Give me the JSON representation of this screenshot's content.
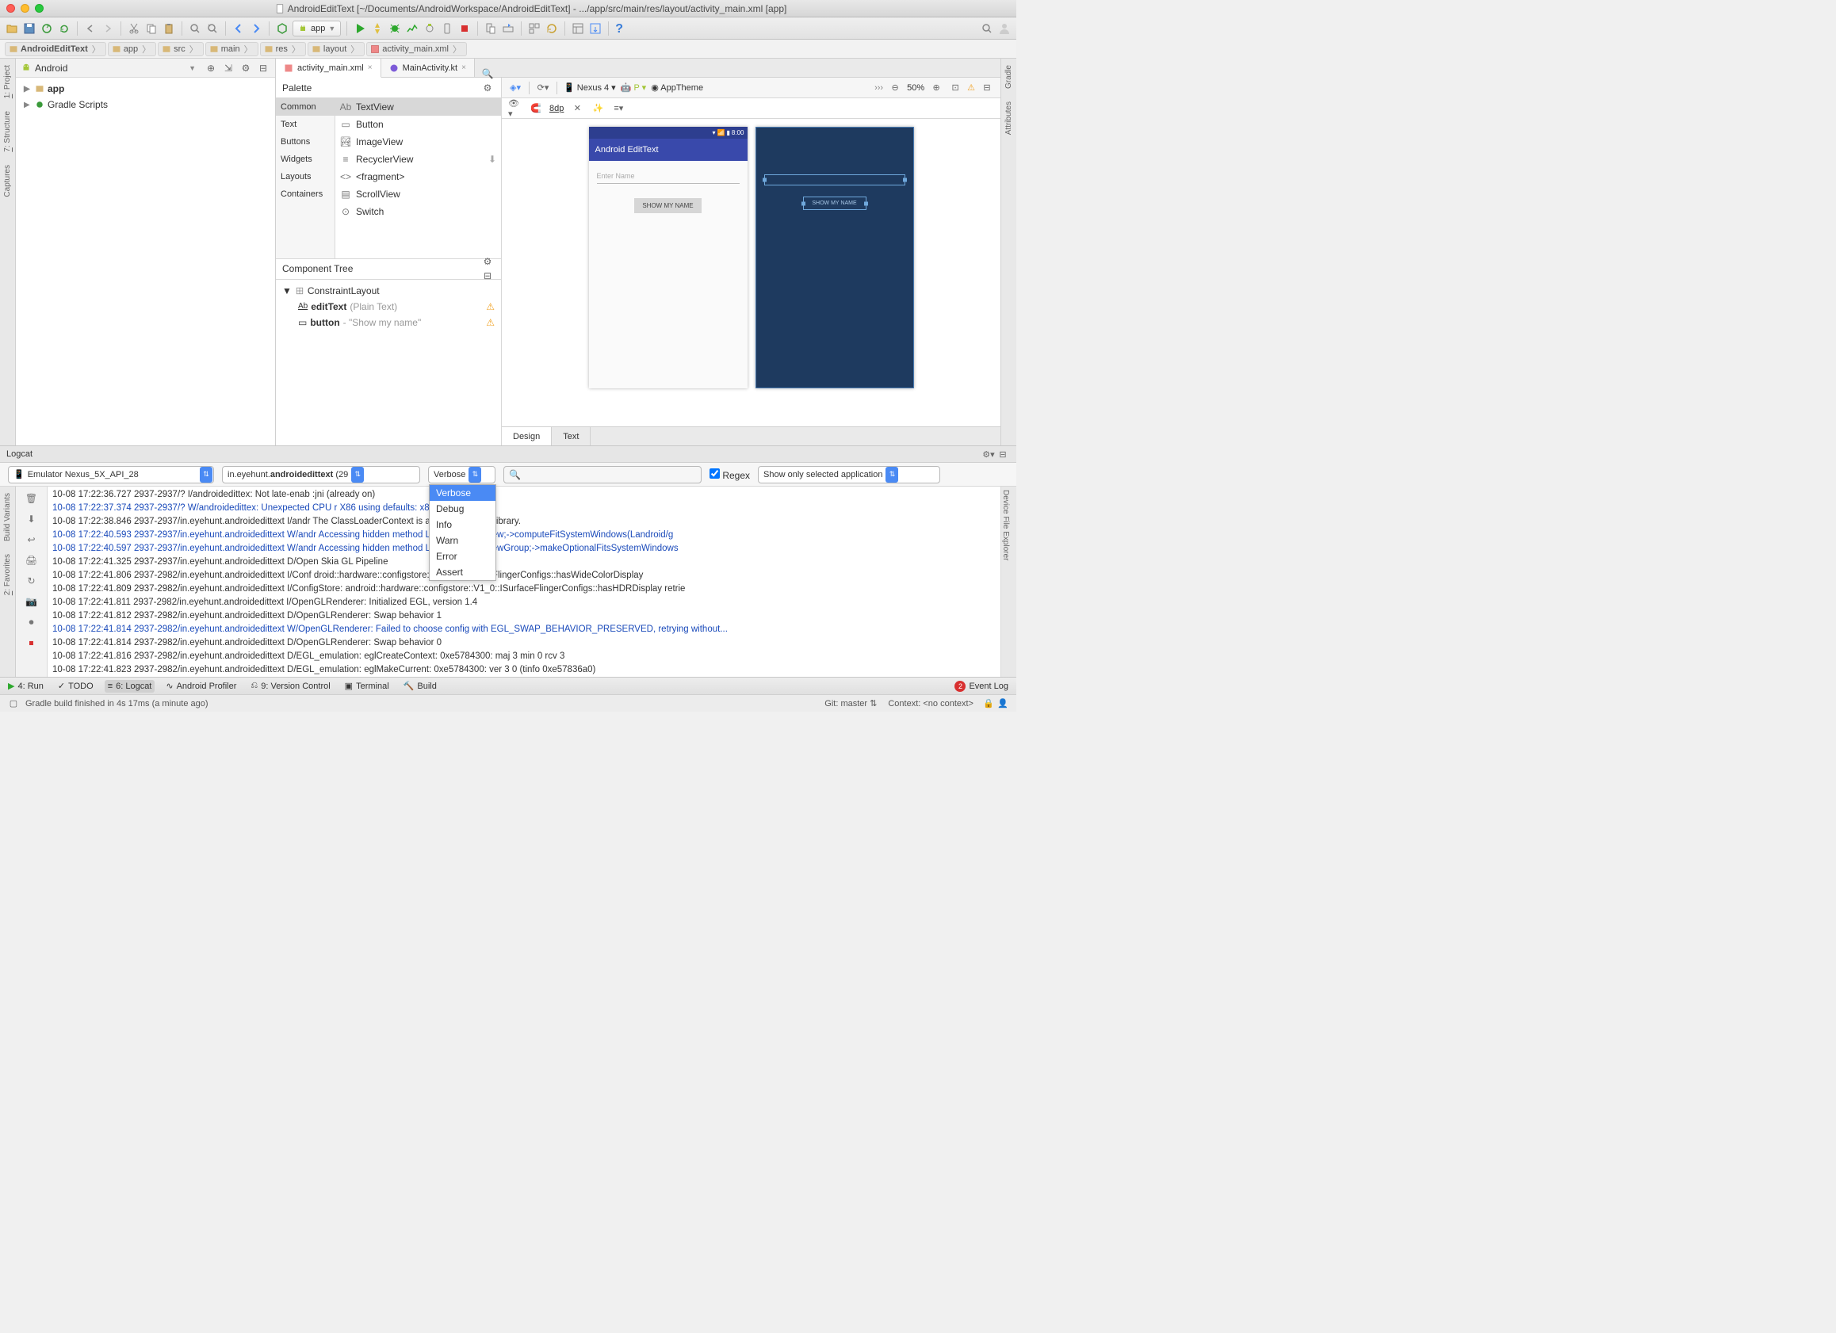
{
  "titlebar": {
    "title": "AndroidEditText [~/Documents/AndroidWorkspace/AndroidEditText] - .../app/src/main/res/layout/activity_main.xml [app]"
  },
  "toolbar": {
    "config": "app"
  },
  "breadcrumb": {
    "items": [
      "AndroidEditText",
      "app",
      "src",
      "main",
      "res",
      "layout",
      "activity_main.xml"
    ]
  },
  "project": {
    "view": "Android",
    "nodes": {
      "app": "app",
      "gradle": "Gradle Scripts"
    }
  },
  "editorTabs": {
    "tab1": "activity_main.xml",
    "tab2": "MainActivity.kt"
  },
  "palette": {
    "title": "Palette",
    "cats": [
      "Common",
      "Text",
      "Buttons",
      "Widgets",
      "Layouts",
      "Containers"
    ],
    "items": [
      "TextView",
      "Button",
      "ImageView",
      "RecyclerView",
      "<fragment>",
      "ScrollView",
      "Switch"
    ]
  },
  "compTree": {
    "title": "Component Tree",
    "root": "ConstraintLayout",
    "n1": {
      "id": "editText",
      "hint": "(Plain Text)"
    },
    "n2": {
      "id": "button",
      "hint": "- \"Show my name\""
    }
  },
  "designer": {
    "device": "Nexus 4",
    "theme": "AppTheme",
    "zoom": "50%",
    "spacing": "8dp",
    "appTitle": "Android EditText",
    "placeholder": "Enter Name",
    "btn": "SHOW MY NAME",
    "statusTime": "8:00",
    "locale": "P",
    "tabs": {
      "design": "Design",
      "text": "Text"
    }
  },
  "logcat": {
    "title": "Logcat",
    "device": "Emulator Nexus_5X_API_28",
    "process": "in.eyehunt.androidedittext (29",
    "level": "Verbose",
    "levels": [
      "Verbose",
      "Debug",
      "Info",
      "Warn",
      "Error",
      "Assert"
    ],
    "regexLabel": "Regex",
    "filter": "Show only selected application",
    "lines": [
      {
        "c": "i",
        "t": "10-08 17:22:36.727 2937-2937/? I/androidedittex: Not late-enab      :jni (already on)"
      },
      {
        "c": "w",
        "t": "10-08 17:22:37.374 2937-2937/? W/androidedittex: Unexpected CPU      r X86 using defaults: x86"
      },
      {
        "c": "i",
        "t": "10-08 17:22:38.846 2937-2937/in.eyehunt.androidedittext I/andr      The ClassLoaderContext is a special shared library."
      },
      {
        "c": "w",
        "t": "10-08 17:22:40.593 2937-2937/in.eyehunt.androidedittext W/andr      Accessing hidden method Landroid/view/View;->computeFitSystemWindows(Landroid/g"
      },
      {
        "c": "w",
        "t": "10-08 17:22:40.597 2937-2937/in.eyehunt.androidedittext W/andr      Accessing hidden method Landroid/view/ViewGroup;->makeOptionalFitsSystemWindows"
      },
      {
        "c": "i",
        "t": "10-08 17:22:41.325 2937-2937/in.eyehunt.androidedittext D/Open      Skia GL Pipeline"
      },
      {
        "c": "i",
        "t": "10-08 17:22:41.806 2937-2982/in.eyehunt.androidedittext I/Conf      droid::hardware::configstore::V1_0::ISurfaceFlingerConfigs::hasWideColorDisplay"
      },
      {
        "c": "i",
        "t": "10-08 17:22:41.809 2937-2982/in.eyehunt.androidedittext I/ConfigStore: android::hardware::configstore::V1_0::ISurfaceFlingerConfigs::hasHDRDisplay retrie"
      },
      {
        "c": "i",
        "t": "10-08 17:22:41.811 2937-2982/in.eyehunt.androidedittext I/OpenGLRenderer: Initialized EGL, version 1.4"
      },
      {
        "c": "i",
        "t": "10-08 17:22:41.812 2937-2982/in.eyehunt.androidedittext D/OpenGLRenderer: Swap behavior 1"
      },
      {
        "c": "w",
        "t": "10-08 17:22:41.814 2937-2982/in.eyehunt.androidedittext W/OpenGLRenderer: Failed to choose config with EGL_SWAP_BEHAVIOR_PRESERVED, retrying without..."
      },
      {
        "c": "i",
        "t": "10-08 17:22:41.814 2937-2982/in.eyehunt.androidedittext D/OpenGLRenderer: Swap behavior 0"
      },
      {
        "c": "i",
        "t": "10-08 17:22:41.816 2937-2982/in.eyehunt.androidedittext D/EGL_emulation: eglCreateContext: 0xe5784300: maj 3 min 0 rcv 3"
      },
      {
        "c": "i",
        "t": "10-08 17:22:41.823 2937-2982/in.eyehunt.androidedittext D/EGL_emulation: eglMakeCurrent: 0xe5784300: ver 3 0 (tinfo 0xe57836a0)"
      }
    ]
  },
  "bottomBar": {
    "run": "4: Run",
    "todo": "TODO",
    "logcat": "6: Logcat",
    "profiler": "Android Profiler",
    "vcs": "9: Version Control",
    "terminal": "Terminal",
    "build": "Build",
    "eventLog": "Event Log",
    "eventCount": "2"
  },
  "statusBar": {
    "msg": "Gradle build finished in 4s 17ms (a minute ago)",
    "git": "Git: master",
    "context": "Context: <no context>"
  }
}
